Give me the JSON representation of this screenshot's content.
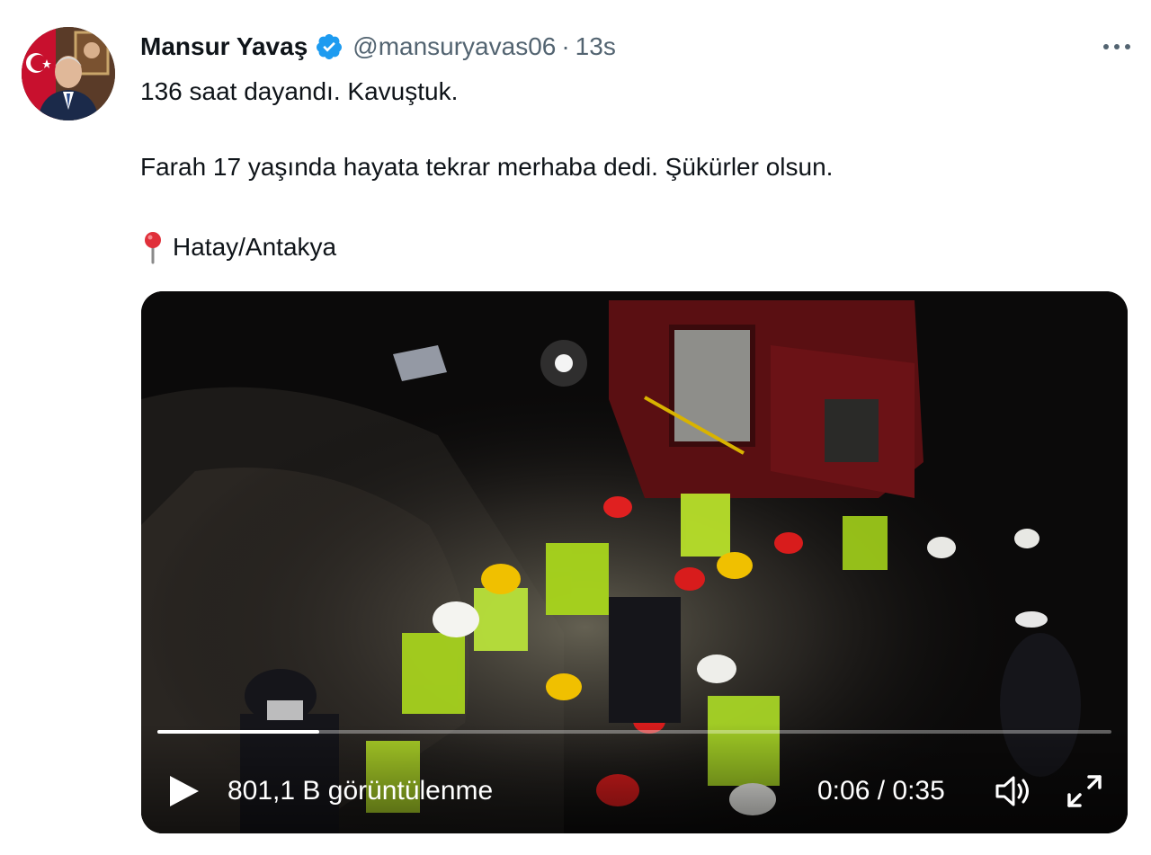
{
  "tweet": {
    "author_name": "Mansur Yavaş",
    "handle": "@mansuryavas06",
    "separator": "·",
    "time": "13s",
    "lines": [
      "136 saat dayandı. Kavuştuk.",
      "Farah 17 yaşında hayata tekrar merhaba dedi. Şükürler olsun.",
      "Hatay/Antakya"
    ],
    "location_icon": "round-pushpin-icon"
  },
  "video": {
    "views_text": "801,1 B görüntülenme",
    "time_text": "0:06 / 0:35",
    "progress": 0.17,
    "icons": [
      "play-icon",
      "volume-icon",
      "fullscreen-icon"
    ]
  },
  "colors": {
    "verified": "#1d9bf0",
    "text": "#0f1419",
    "secondary": "#536471",
    "pin": "#e0303a"
  }
}
